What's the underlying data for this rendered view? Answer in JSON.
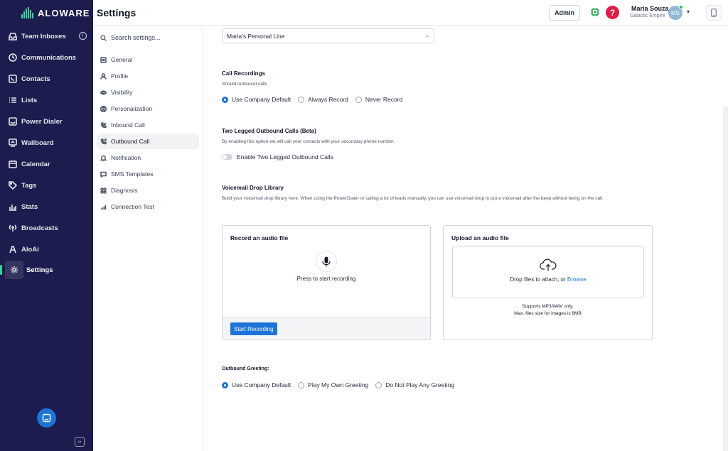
{
  "app": {
    "logo_text": "ALOWARE",
    "page_title": "Settings"
  },
  "nav": {
    "items": [
      {
        "label": "Team Inboxes",
        "icon": "inbox-icon"
      },
      {
        "label": "Communications",
        "icon": "clock-icon"
      },
      {
        "label": "Contacts",
        "icon": "contacts-icon"
      },
      {
        "label": "Lists",
        "icon": "list-icon"
      },
      {
        "label": "Power Dialer",
        "icon": "dialer-icon"
      },
      {
        "label": "Wallboard",
        "icon": "wallboard-icon"
      },
      {
        "label": "Calendar",
        "icon": "calendar-icon"
      },
      {
        "label": "Tags",
        "icon": "tag-icon"
      },
      {
        "label": "Stats",
        "icon": "stats-icon"
      },
      {
        "label": "Broadcasts",
        "icon": "broadcast-icon"
      },
      {
        "label": "AloAi",
        "icon": "ai-icon"
      },
      {
        "label": "Settings",
        "icon": "gear-icon"
      }
    ],
    "active": "Settings",
    "collapse_glyph": "‹›"
  },
  "header": {
    "admin_label": "Admin",
    "help_glyph": "?",
    "user_name": "Maria Souza",
    "user_org": "Galactic Empire",
    "avatar_initials": "MS"
  },
  "settings_nav": {
    "search_placeholder": "Search settings...",
    "items": [
      {
        "label": "General"
      },
      {
        "label": "Profile"
      },
      {
        "label": "Visibility"
      },
      {
        "label": "Personalization"
      },
      {
        "label": "Inbound Call"
      },
      {
        "label": "Outbound Call"
      },
      {
        "label": "Notification"
      },
      {
        "label": "SMS Templates"
      },
      {
        "label": "Diagnosis"
      },
      {
        "label": "Connection Test"
      }
    ],
    "active": "Outbound Call"
  },
  "main": {
    "line_select_value": "Maria's Personal Line",
    "call_recordings": {
      "title": "Call Recordings",
      "desc": "Should outbound calls",
      "options": [
        "Use Company Default",
        "Always Record",
        "Never Record"
      ],
      "selected": "Use Company Default"
    },
    "two_legged": {
      "title": "Two Legged Outbound Calls (Beta)",
      "desc": "By enabling this option we will call your contacts with your secondary phone number.",
      "toggle_label": "Enable Two Legged Outbound Calls",
      "enabled": false
    },
    "voicemail": {
      "title": "Voicemail Drop Library",
      "desc": "Build your voicemail drop library here. When using the PowerDialer or calling a lot of leads manually, you can use voicemail drop to put a voicemail after the beep without being on the call."
    },
    "record_card": {
      "title": "Record an audio file",
      "press_text": "Press to start recording",
      "button_label": "Start Recording"
    },
    "upload_card": {
      "title": "Upload an audio file",
      "drop_text": "Drop files to attach, or ",
      "browse_label": "Browse",
      "support_line1": "Supports MP3/WAV only.",
      "support_line2": "Max. files size for images is 8MB"
    },
    "greeting": {
      "title": "Outbound Greeting:",
      "options": [
        "Use Company Default",
        "Play My Own Greeting",
        "Do Not Play Any Greeting"
      ],
      "selected": "Use Company Default"
    }
  },
  "colors": {
    "nav_bg": "#1c1c4f",
    "accent": "#1d74d8",
    "brand_green": "#34d399",
    "help_red": "#e11d48"
  }
}
